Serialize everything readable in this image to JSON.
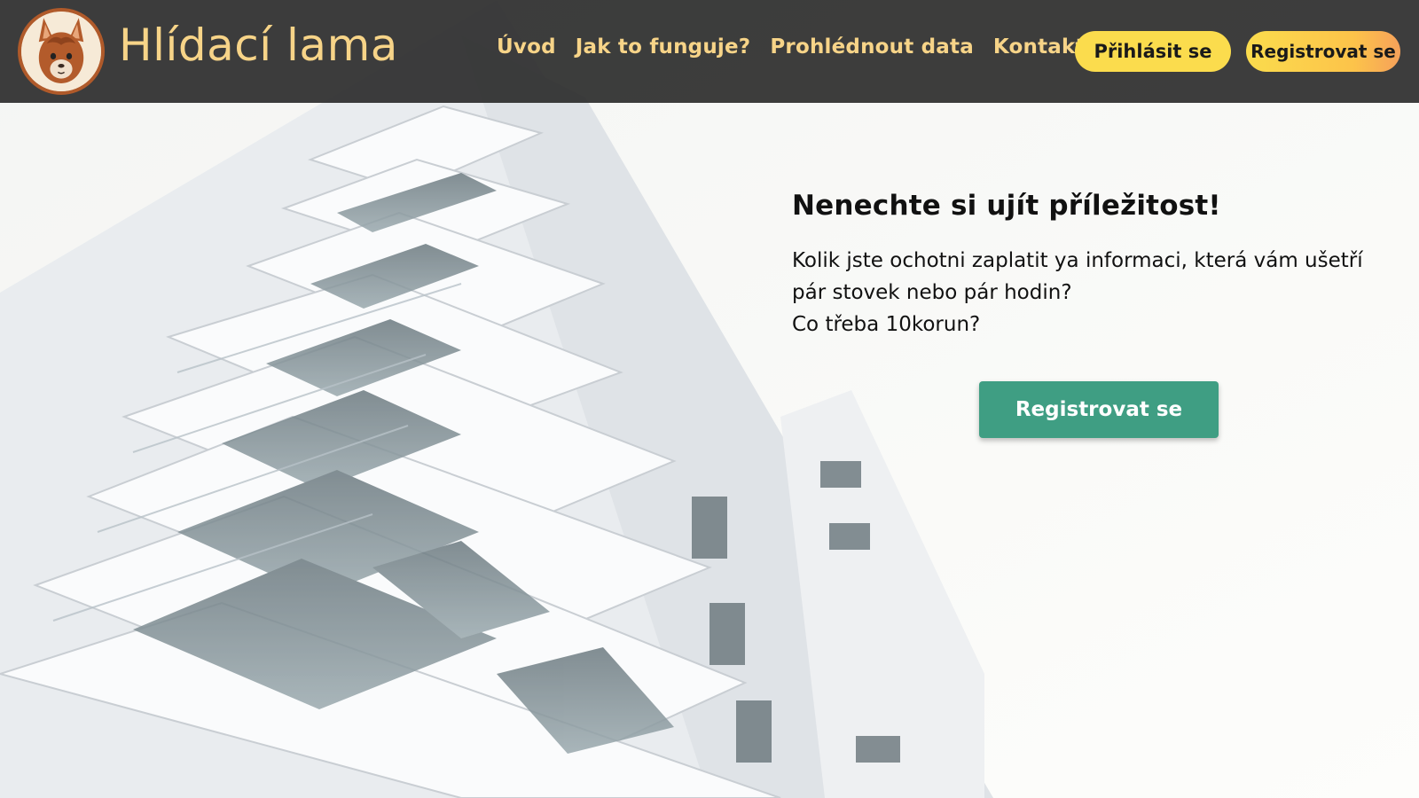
{
  "header": {
    "brand_title": "Hlídací lama",
    "logo_icon": "llama-face-icon",
    "nav": [
      {
        "label": "Úvod"
      },
      {
        "label": "Jak to funguje?"
      },
      {
        "label": "Prohlédnout data"
      },
      {
        "label": "Kontakt"
      }
    ],
    "login_label": "Přihlásit se",
    "register_label": "Registrovat se"
  },
  "hero": {
    "heading": "Nenechte si ujít příležitost!",
    "paragraph_line1": "Kolik jste ochotni zaplatit ya informaci, která vám ušetří pár stovek nebo pár hodin?",
    "paragraph_line2": "Co třeba 10korun?",
    "cta_label": "Registrovat se"
  },
  "colors": {
    "header_bg": "#282828",
    "accent_yellow": "#fbdc4d",
    "brand_text": "#f7d488",
    "cta_green": "#3f9e83"
  }
}
